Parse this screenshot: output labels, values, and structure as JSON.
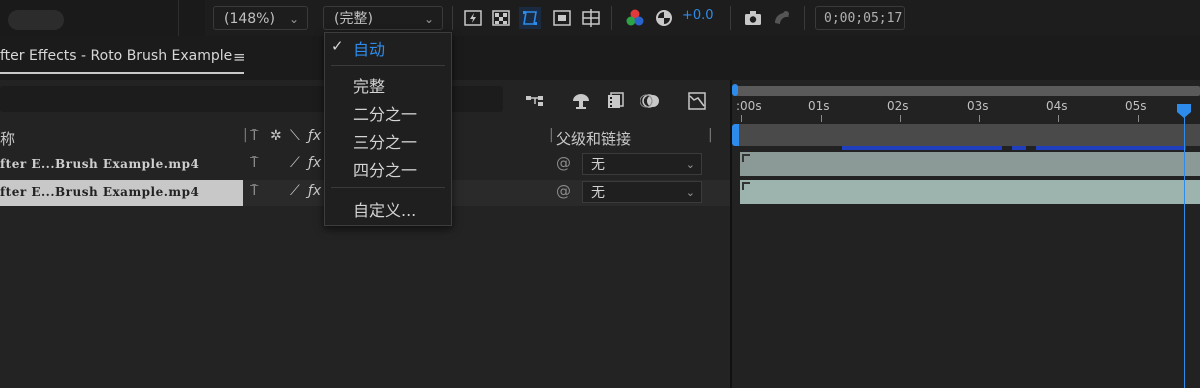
{
  "toolbar": {
    "zoom_value": "(148%)",
    "resolution_value": "(完整)",
    "exposure_value": "+0.0",
    "timecode": "0;00;05;17",
    "colors": {
      "accent": "#2d8ceb"
    }
  },
  "panel": {
    "comp_tab_label": "fter Effects - Roto Brush Example",
    "tab_menu_icon": "hamburger-icon"
  },
  "layers": {
    "name_header": "称",
    "parent_header": "父级和链接",
    "rows": [
      {
        "name": "fter E...Brush Example.mp4",
        "parent": "无"
      },
      {
        "name": "fter E...Brush Example.mp4",
        "parent": "无"
      }
    ]
  },
  "timeline": {
    "ticks": [
      ":00s",
      "01s",
      "02s",
      "03s",
      "04s",
      "05s"
    ]
  },
  "resolution_menu": {
    "items": [
      {
        "label": "自动",
        "selected": true
      },
      {
        "label": "完整",
        "selected": false
      },
      {
        "label": "二分之一",
        "selected": false
      },
      {
        "label": "三分之一",
        "selected": false
      },
      {
        "label": "四分之一",
        "selected": false
      },
      {
        "label": "自定义...",
        "selected": false
      }
    ],
    "check_glyph": "✓"
  }
}
